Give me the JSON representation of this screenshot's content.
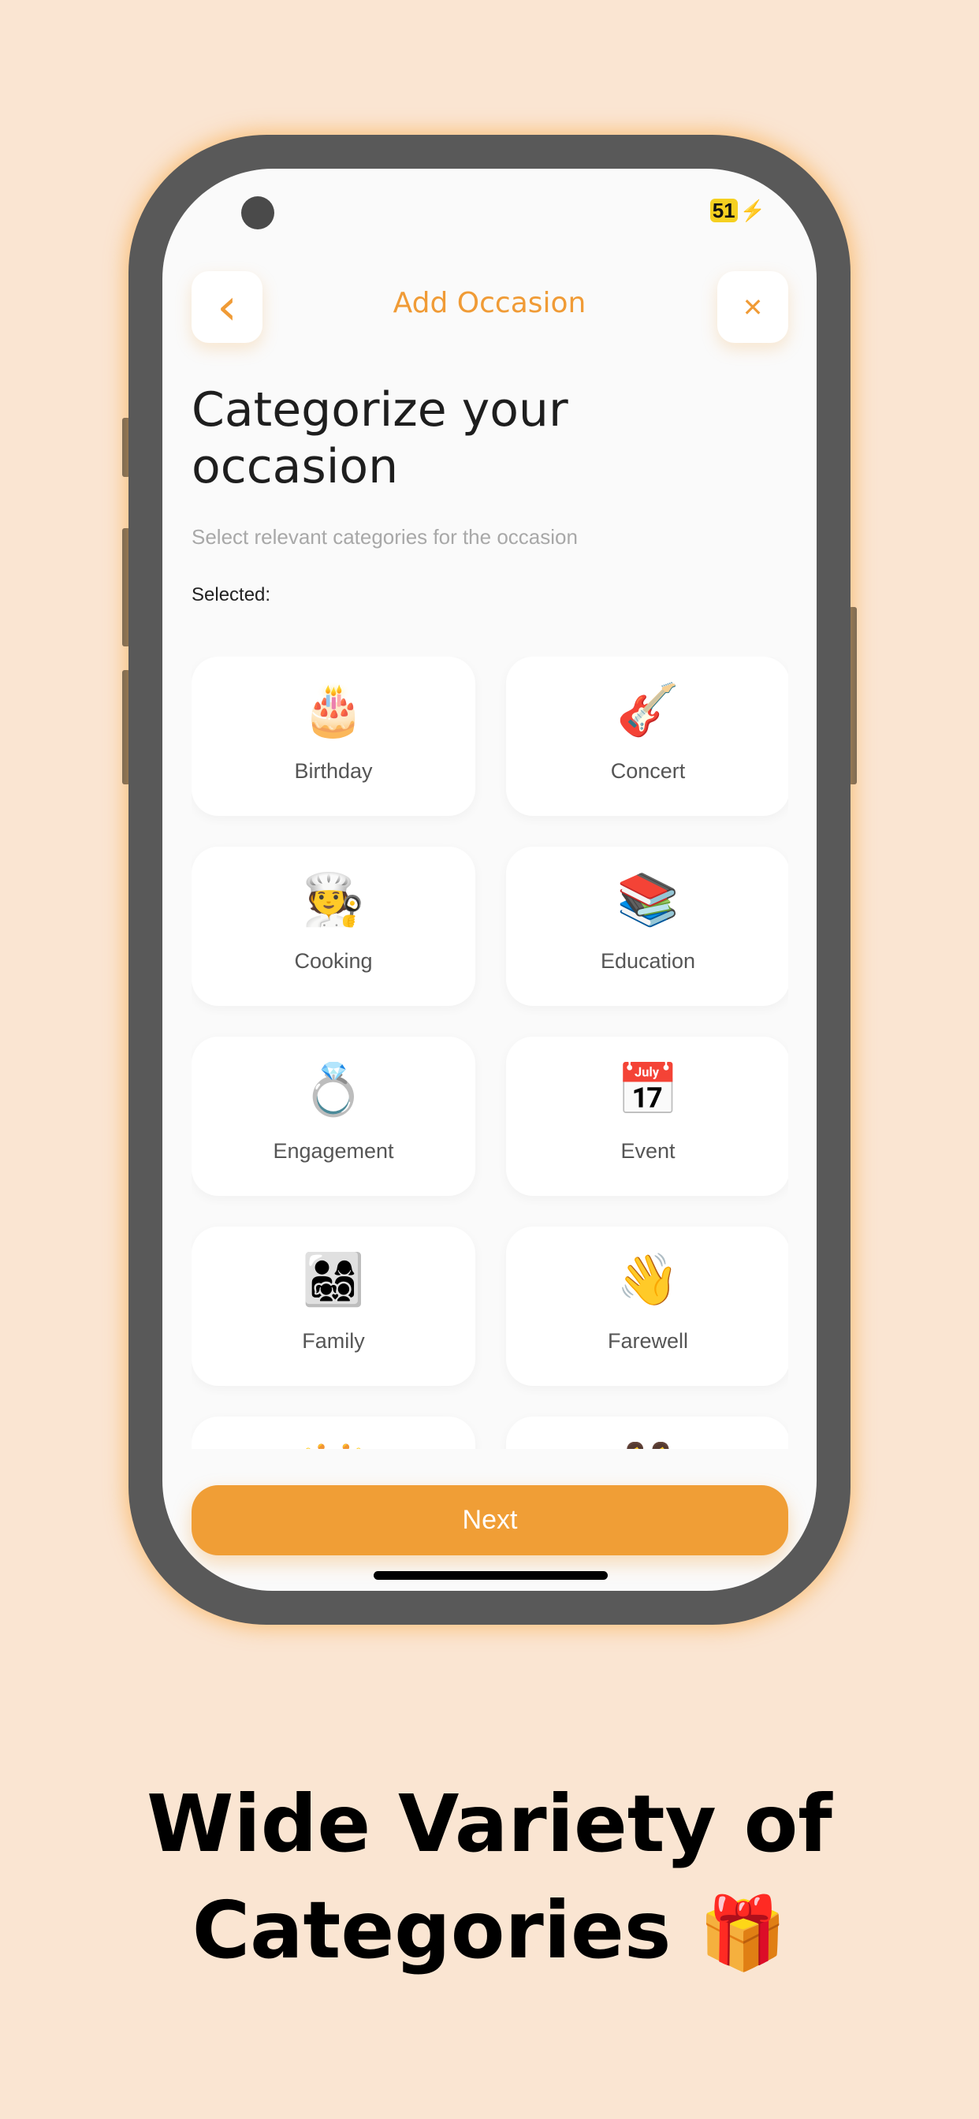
{
  "status_bar": {
    "battery": "51",
    "charging_icon": "⚡"
  },
  "header": {
    "title": "Add Occasion",
    "back_icon": "‹",
    "close_icon": "✕"
  },
  "heading": {
    "line1": "Categorize your",
    "line2": "occasion"
  },
  "subtitle": "Select relevant categories for the occasion",
  "selected_label": "Selected:",
  "categories": [
    {
      "label": "Birthday",
      "icon": "🎂"
    },
    {
      "label": "Concert",
      "icon": "🎸"
    },
    {
      "label": "Cooking",
      "icon": "🧑‍🍳"
    },
    {
      "label": "Education",
      "icon": "📚"
    },
    {
      "label": "Engagement",
      "icon": "💍"
    },
    {
      "label": "Event",
      "icon": "📅"
    },
    {
      "label": "Family",
      "icon": "👨‍👩‍👧‍👦"
    },
    {
      "label": "Farewell",
      "icon": "👋"
    },
    {
      "label": "",
      "icon": "👑"
    },
    {
      "label": "",
      "icon": "👭"
    }
  ],
  "next_label": "Next",
  "caption": {
    "line1": "Wide Variety of",
    "line2": "Categories",
    "emoji": "🎁"
  },
  "colors": {
    "accent": "#f09e36",
    "background": "#fae5d2",
    "frame": "#595959"
  }
}
